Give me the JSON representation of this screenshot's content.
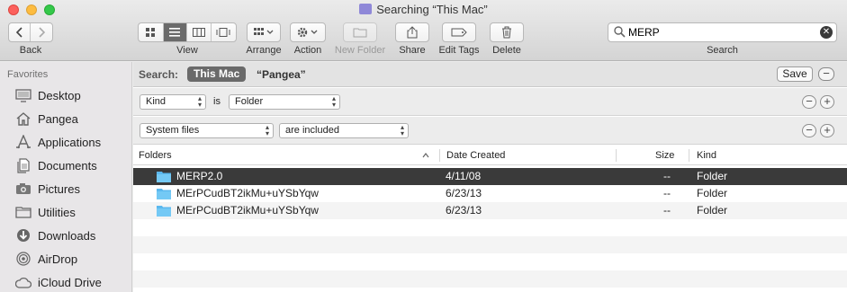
{
  "window": {
    "title": "Searching “This Mac”"
  },
  "toolbar": {
    "back_label": "Back",
    "view_label": "View",
    "arrange_label": "Arrange",
    "action_label": "Action",
    "new_folder_label": "New Folder",
    "share_label": "Share",
    "edit_tags_label": "Edit Tags",
    "delete_label": "Delete",
    "search_label": "Search",
    "search_value": "MERP",
    "view_active_mode": "list"
  },
  "sidebar": {
    "heading": "Favorites",
    "items": [
      {
        "label": "Desktop",
        "icon": "desktop-icon"
      },
      {
        "label": "Pangea",
        "icon": "home-icon"
      },
      {
        "label": "Applications",
        "icon": "applications-icon"
      },
      {
        "label": "Documents",
        "icon": "documents-icon"
      },
      {
        "label": "Pictures",
        "icon": "camera-icon"
      },
      {
        "label": "Utilities",
        "icon": "folder-icon"
      },
      {
        "label": "Downloads",
        "icon": "download-icon"
      },
      {
        "label": "AirDrop",
        "icon": "airdrop-icon"
      },
      {
        "label": "iCloud Drive",
        "icon": "cloud-icon"
      }
    ]
  },
  "search_scope": {
    "label": "Search:",
    "this_mac": "This Mac",
    "pangea": "“Pangea”",
    "save_label": "Save"
  },
  "criteria": [
    {
      "attribute": "Kind",
      "operator": "is",
      "value": "Folder"
    },
    {
      "attribute": "System files",
      "value": "are included"
    }
  ],
  "table": {
    "columns": {
      "name": "Folders",
      "date": "Date Created",
      "size": "Size",
      "kind": "Kind"
    },
    "rows": [
      {
        "name": "MERP2.0",
        "date": "4/11/08",
        "size": "--",
        "kind": "Folder",
        "selected": true
      },
      {
        "name": "MErPCudBT2ikMu+uYSbYqw",
        "date": "6/23/13",
        "size": "--",
        "kind": "Folder"
      },
      {
        "name": "MErPCudBT2ikMu+uYSbYqw",
        "date": "6/23/13",
        "size": "--",
        "kind": "Folder"
      }
    ]
  },
  "colors": {
    "selected_row": "#3a3a3a",
    "folder": "#6ec4f2",
    "close": "#fc605c",
    "minimize": "#fdbc40",
    "maximize": "#34c84a"
  }
}
